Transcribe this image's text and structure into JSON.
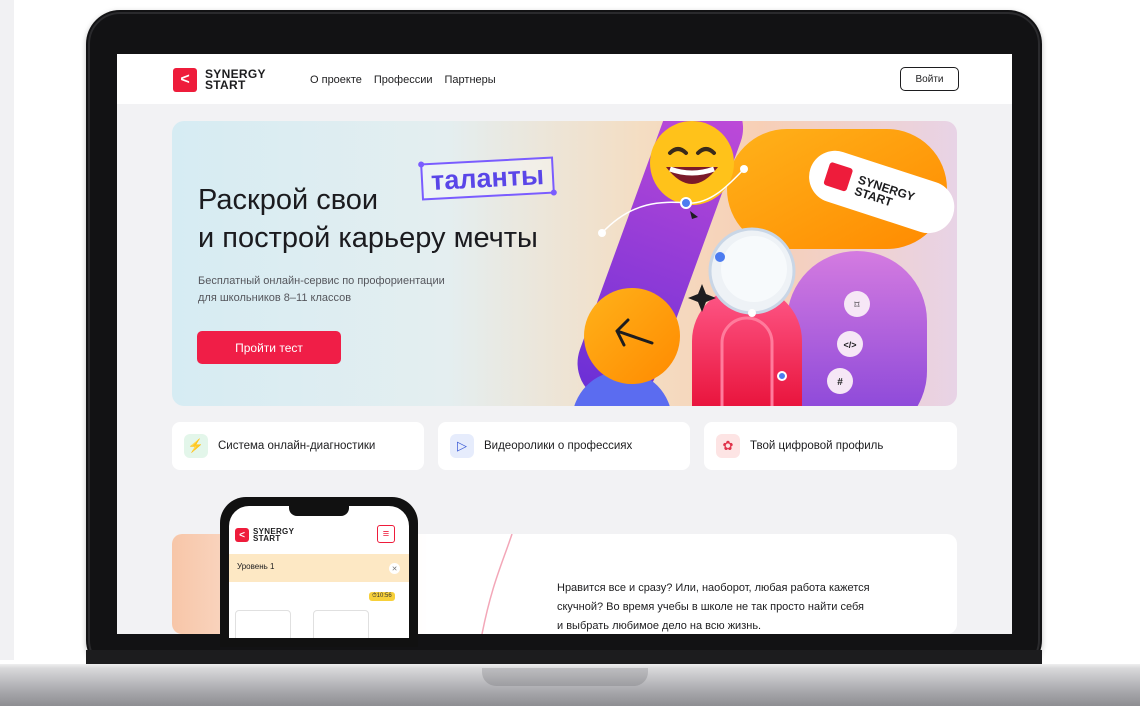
{
  "brand": {
    "name_line1": "SYNERGY",
    "name_line2": "START",
    "accent": "#ee1c3b"
  },
  "nav": {
    "items": [
      "О проекте",
      "Профессии",
      "Партнеры"
    ],
    "login_label": "Войти"
  },
  "hero": {
    "title_line1": "Раскрой свои",
    "title_line2": "и построй карьеру мечты",
    "tag": "таланты",
    "subtitle_line1": "Бесплатный онлайн-сервис по профориентации",
    "subtitle_line2": "для школьников 8–11 классов",
    "cta_label": "Пройти тест",
    "cta_color": "#f01e47",
    "badge_glyphs": [
      "⌑",
      "</>",
      "#"
    ]
  },
  "features": [
    {
      "icon": "lightning-icon",
      "label": "Система онлайн-диагностики"
    },
    {
      "icon": "video-play-icon",
      "label": "Видеоролики о профессиях"
    },
    {
      "icon": "brain-icon",
      "label": "Твой цифровой профиль"
    }
  ],
  "lower": {
    "text_line1": "Нравится все и сразу? Или, наоборот, любая работа кажется",
    "text_line2": "скучной? Во время учебы в школе не так просто найти себя",
    "text_line3": "и выбрать любимое дело на всю жизнь."
  },
  "phone": {
    "level_label": "Уровень 1",
    "timer": "⏱10:56"
  }
}
